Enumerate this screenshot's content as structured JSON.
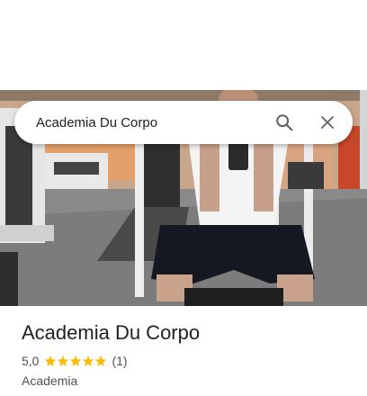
{
  "search": {
    "query": "Academia Du Corpo"
  },
  "place": {
    "name": "Academia Du Corpo",
    "rating": "5,0",
    "stars": 5,
    "review_count": "(1)",
    "category": "Academia"
  },
  "colors": {
    "star": "#fbbc04",
    "text_primary": "#202124",
    "text_secondary": "#4d5156",
    "icon": "#5f6368"
  },
  "icons": {
    "search": "search-icon",
    "close": "close-icon",
    "star": "star-icon"
  }
}
